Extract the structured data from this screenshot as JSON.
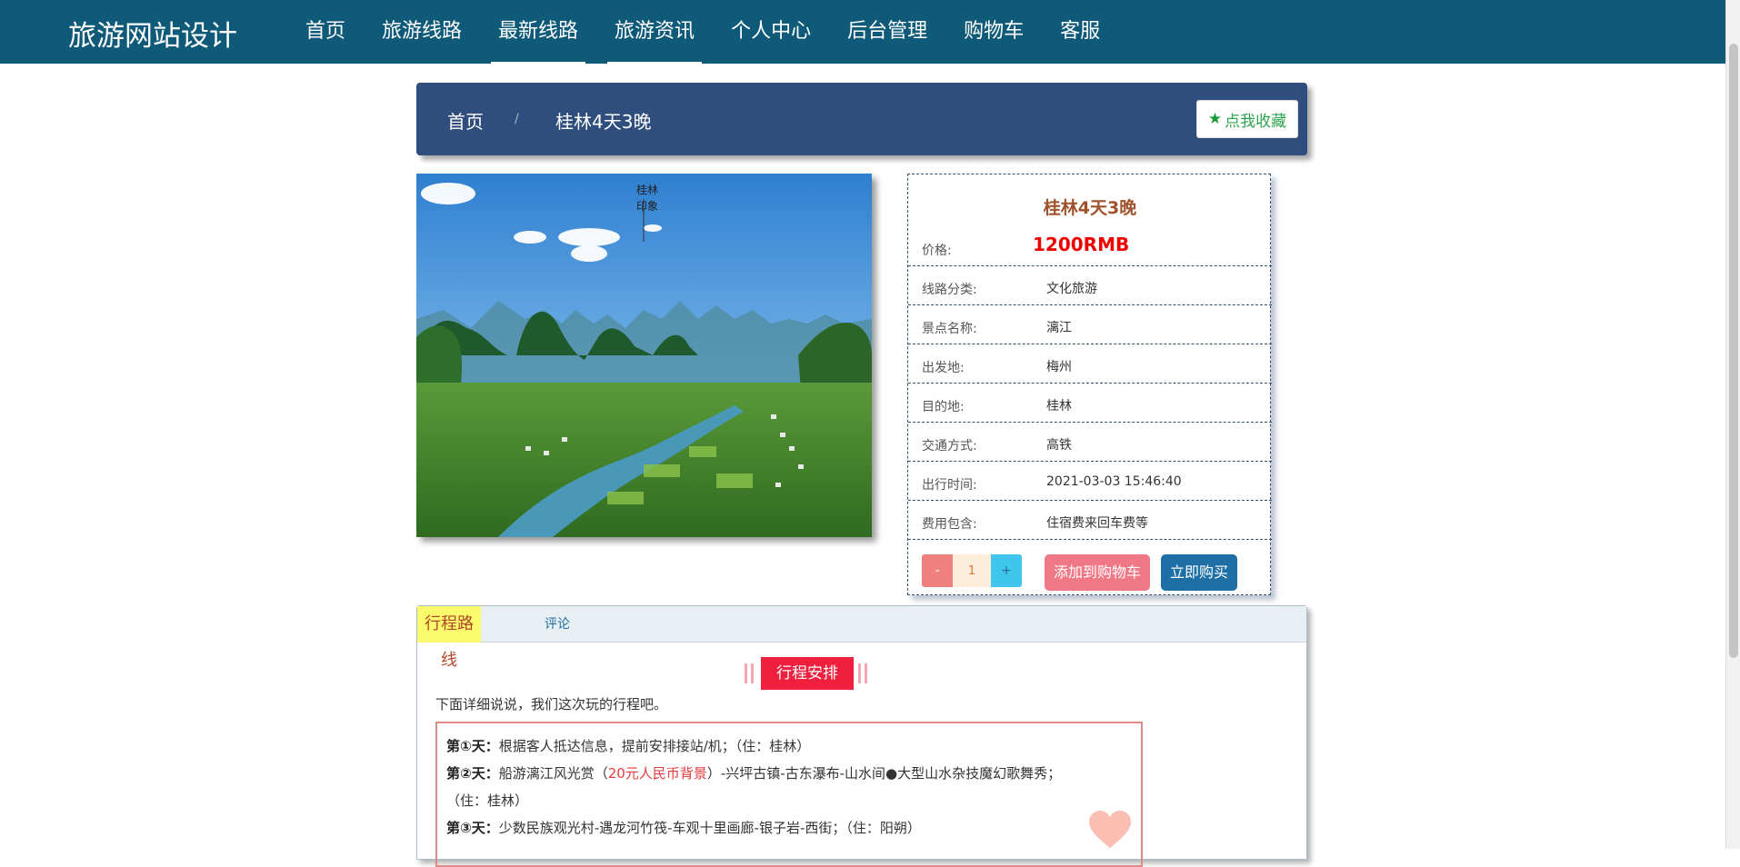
{
  "header": {
    "brand": "旅游网站设计",
    "nav": [
      {
        "label": "首页"
      },
      {
        "label": "旅游线路"
      },
      {
        "label": "最新线路"
      },
      {
        "label": "旅游资讯"
      },
      {
        "label": "个人中心"
      },
      {
        "label": "后台管理"
      },
      {
        "label": "购物车"
      },
      {
        "label": "客服"
      }
    ]
  },
  "breadcrumb": {
    "home": "首页",
    "separator": "/",
    "current": "桂林4天3晚",
    "favorite_label": "点我收藏"
  },
  "photo": {
    "caption_line1": "桂林",
    "caption_line2": "印象"
  },
  "details": {
    "title": "桂林4天3晚",
    "rows": [
      {
        "key": "价格:",
        "value": "1200RMB"
      },
      {
        "key": "线路分类:",
        "value": "文化旅游"
      },
      {
        "key": "景点名称:",
        "value": "漓江"
      },
      {
        "key": "出发地:",
        "value": "梅州"
      },
      {
        "key": "目的地:",
        "value": "桂林"
      },
      {
        "key": "交通方式:",
        "value": "高铁"
      },
      {
        "key": "出行时间:",
        "value": "2021-03-03 15:46:40"
      },
      {
        "key": "费用包含:",
        "value": "住宿费来回车费等"
      }
    ],
    "qty_minus": "-",
    "qty_value": "1",
    "qty_plus": "+",
    "add_to_cart": "添加到购物车",
    "buy_now": "立即购买"
  },
  "tabs": {
    "route": "行程路线",
    "comment": "评论"
  },
  "itinerary": {
    "heading": "行程安排",
    "intro": "下面详细说说，我们这次玩的行程吧。",
    "day1_label": "第①天：",
    "day1_text": "根据客人抵达信息，提前安排接站/机；（住：桂林）",
    "day2_label": "第②天：",
    "day2_pre": "船游漓江风光赏（",
    "day2_highlight": "20元人民币背景",
    "day2_post": "）-兴坪古镇-古东瀑布-山水间●大型山水杂技魔幻歌舞秀；",
    "day2_stay": "（住：桂林）",
    "day3_label": "第③天：",
    "day3_text": "少数民族观光村-遇龙河竹筏-车观十里画廊-银子岩-西街；（住：阳朔）"
  },
  "colors": {
    "topbar": "#0e5a78",
    "breadcrumb_bar": "#2f4e7e",
    "price": "#ee0000",
    "title": "#a0522d",
    "cart_button": "#f07886",
    "buy_button": "#1d6fa5",
    "schedule_badge": "#f01f3d"
  }
}
